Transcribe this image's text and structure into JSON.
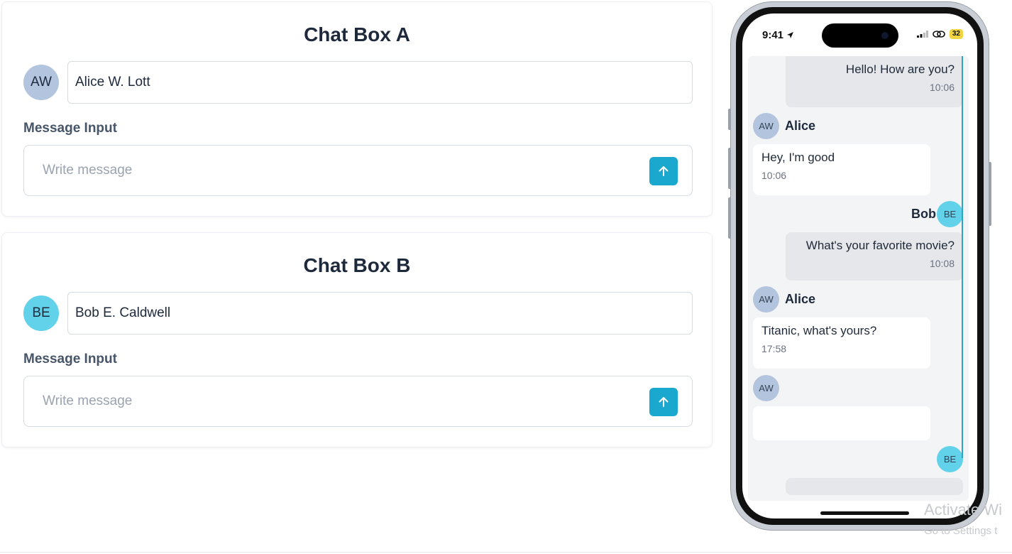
{
  "colors": {
    "accent": "#1ba8cf",
    "avatar_alice": "#b3c5de",
    "avatar_bob": "#61d2ea"
  },
  "chat_box_a": {
    "title": "Chat Box A",
    "avatar_initials": "AW",
    "name_value": "Alice W. Lott",
    "message_label": "Message Input",
    "message_placeholder": "Write message",
    "send_icon": "arrow-up-icon"
  },
  "chat_box_b": {
    "title": "Chat Box B",
    "avatar_initials": "BE",
    "name_value": "Bob E. Caldwell",
    "message_label": "Message Input",
    "message_placeholder": "Write message",
    "send_icon": "arrow-up-icon"
  },
  "phone": {
    "status_time": "9:41",
    "battery": "32",
    "messages": [
      {
        "side": "right",
        "text": "Hello! How are you?",
        "time": "10:06"
      },
      {
        "side": "left",
        "sender": "Alice",
        "initials": "AW",
        "text": "Hey, I'm good",
        "time": "10:06"
      },
      {
        "side": "right",
        "sender": "Bob",
        "initials": "BE",
        "text": "What's your favorite movie?",
        "time": "10:08"
      },
      {
        "side": "left",
        "sender": "Alice",
        "initials": "AW",
        "text": "Titanic, what's yours?",
        "time": "17:58"
      },
      {
        "side": "left",
        "initials": "AW",
        "text": "",
        "time": ""
      },
      {
        "side": "right",
        "initials": "BE",
        "text": "",
        "time": ""
      }
    ]
  },
  "watermark": {
    "line1": "Activate Wi",
    "line2": "Go to Settings t"
  }
}
